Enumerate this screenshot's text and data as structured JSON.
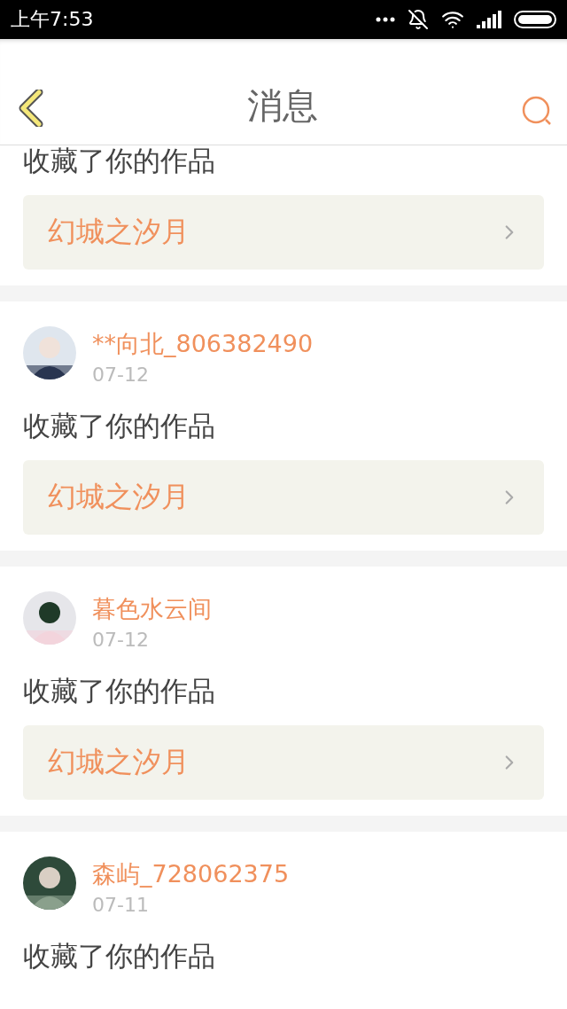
{
  "status_bar": {
    "time": "上午7:53"
  },
  "header": {
    "title": "消息"
  },
  "messages": [
    {
      "action": "收藏了你的作品",
      "work": "幻城之汐月"
    },
    {
      "user": {
        "name": "**向北_806382490"
      },
      "date": "07-12",
      "action": "收藏了你的作品",
      "work": "幻城之汐月"
    },
    {
      "user": {
        "name": "暮色水云间"
      },
      "date": "07-12",
      "action": "收藏了你的作品",
      "work": "幻城之汐月"
    },
    {
      "user": {
        "name": "森屿_728062375"
      },
      "date": "07-11",
      "action": "收藏了你的作品"
    }
  ]
}
